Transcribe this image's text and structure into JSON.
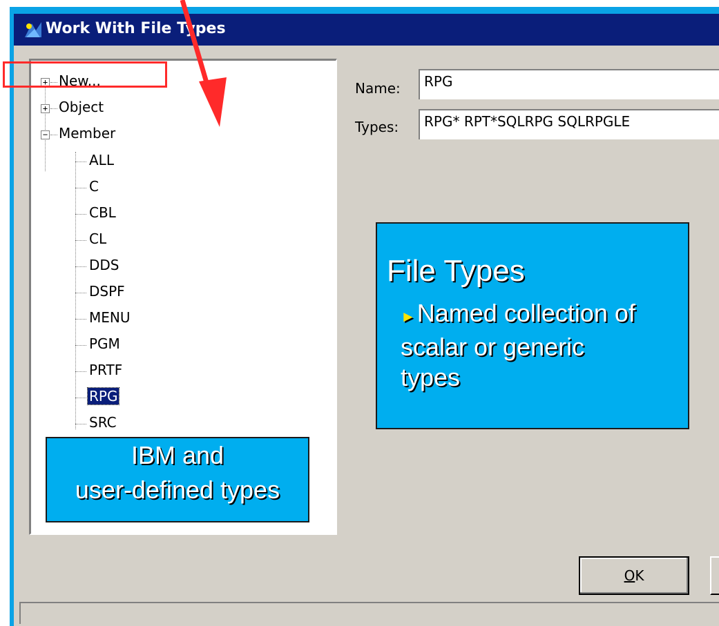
{
  "window": {
    "title": "Work With File Types"
  },
  "tree": {
    "roots": [
      {
        "label": "New...",
        "expander": "+"
      },
      {
        "label": "Object",
        "expander": "+"
      },
      {
        "label": "Member",
        "expander": "−"
      }
    ],
    "member_children": [
      "ALL",
      "C",
      "CBL",
      "CL",
      "DDS",
      "DSPF",
      "MENU",
      "PGM",
      "PRTF",
      "RPG",
      "SRC"
    ],
    "selected": "RPG"
  },
  "form": {
    "name_label": "Name:",
    "name_value": "RPG",
    "types_label": "Types:",
    "types_value": "RPG* RPT*SQLRPG SQLRPGLE"
  },
  "callouts": {
    "file_types": {
      "heading": "File Types",
      "bullet_line1": "Named collection of",
      "bullet_line2": "scalar or generic",
      "bullet_line3": "types"
    },
    "ibm_types": {
      "line1": "IBM and",
      "line2": "user-defined types"
    }
  },
  "buttons": {
    "ok_mnemonic": "O",
    "ok_rest": "K"
  },
  "colors": {
    "titlebar": "#0a1e7a",
    "callout_bg": "#00aeef",
    "annotation_red": "#ff2a2a",
    "dialog_bg": "#d4d0c8"
  },
  "icons": {
    "title": "window-app-icon",
    "bullet": "triangle-bullet-icon",
    "arrow": "red-annotation-arrow"
  }
}
